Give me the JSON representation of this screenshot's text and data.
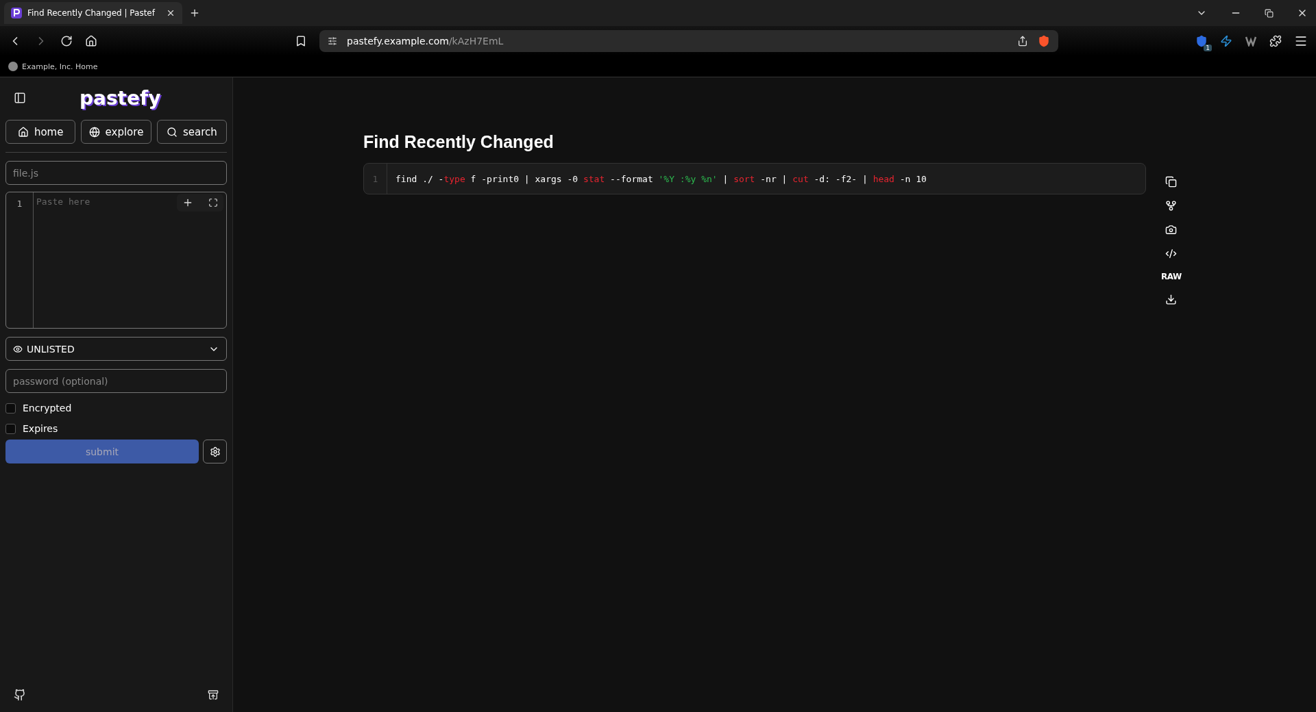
{
  "browser": {
    "tab": {
      "title": "Find Recently Changed | Pastef",
      "selected": true
    },
    "url": {
      "host": "pastefy.example.com",
      "path": "/kAzH7EmL"
    },
    "extension_badge": "1",
    "bookmarks": [
      "Example, Inc. Home"
    ]
  },
  "sidebar": {
    "logo": "pastefy",
    "nav": [
      {
        "label": "home"
      },
      {
        "label": "explore"
      },
      {
        "label": "search"
      }
    ],
    "filename": {
      "placeholder": "file.js"
    },
    "editor": {
      "line_numbers": [
        "1"
      ],
      "placeholder": "Paste here"
    },
    "visibility": {
      "value": "UNLISTED"
    },
    "password": {
      "placeholder": "password (optional)"
    },
    "options": [
      {
        "label": "Encrypted",
        "checked": false
      },
      {
        "label": "Expires",
        "checked": false
      }
    ],
    "submit": {
      "label": "submit",
      "disabled": true
    }
  },
  "paste": {
    "title": "Find Recently Changed",
    "lines": [
      {
        "number": "1",
        "tokens": [
          {
            "kind": "plain",
            "text": "find ./ -"
          },
          {
            "kind": "keyword",
            "text": "type"
          },
          {
            "kind": "plain",
            "text": " f -print0 | xargs -0 "
          },
          {
            "kind": "keyword",
            "text": "stat"
          },
          {
            "kind": "plain",
            "text": " --format "
          },
          {
            "kind": "string",
            "text": "'%Y :%y %n'"
          },
          {
            "kind": "plain",
            "text": " | "
          },
          {
            "kind": "keyword",
            "text": "sort"
          },
          {
            "kind": "plain",
            "text": " -nr | "
          },
          {
            "kind": "keyword",
            "text": "cut"
          },
          {
            "kind": "plain",
            "text": " -d: -f2- | "
          },
          {
            "kind": "keyword",
            "text": "head"
          },
          {
            "kind": "plain",
            "text": " -n 10"
          }
        ]
      }
    ],
    "actions": [
      {
        "kind": "icon"
      },
      {
        "kind": "icon"
      },
      {
        "kind": "icon"
      },
      {
        "kind": "icon"
      },
      {
        "kind": "text",
        "label": "RAW"
      },
      {
        "kind": "icon"
      }
    ]
  }
}
